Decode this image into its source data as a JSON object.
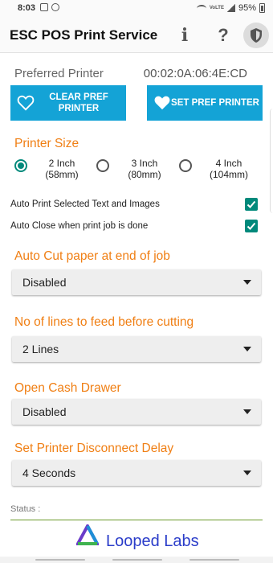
{
  "status_bar": {
    "time": "8:03",
    "lte_label": "VoLTE",
    "battery": "95%"
  },
  "app_bar": {
    "title": "ESC POS Print Service",
    "info_icon": "i",
    "help_icon": "?"
  },
  "preferred_printer": {
    "label": "Preferred Printer",
    "mac": "00:02:0A:06:4E:CD",
    "clear_button": "CLEAR PREF PRINTER",
    "set_button": "SET PREF PRINTER"
  },
  "printer_size": {
    "title": "Printer Size",
    "options": [
      {
        "label": "2 Inch\n(58mm)",
        "checked": true
      },
      {
        "label": "3 Inch\n(80mm)",
        "checked": false
      },
      {
        "label": "4 Inch\n(104mm)",
        "checked": false
      }
    ]
  },
  "options": {
    "auto_print": {
      "label": "Auto Print Selected Text and Images",
      "checked": true
    },
    "auto_close": {
      "label": "Auto Close when print job is done",
      "checked": true
    }
  },
  "auto_cut": {
    "title": "Auto Cut paper at end of job",
    "value": "Disabled"
  },
  "feed_lines": {
    "title": "No of lines to feed before cutting",
    "value": "2 Lines"
  },
  "cash_drawer": {
    "title": "Open Cash Drawer",
    "value": "Disabled"
  },
  "disconnect_delay": {
    "title": "Set Printer Disconnect Delay",
    "value": "4 Seconds"
  },
  "status": {
    "label": "Status :"
  },
  "footer": {
    "brand": "Looped Labs"
  },
  "colors": {
    "accent": "#f07f14",
    "button": "#14a3d6",
    "check": "#00897b",
    "brand": "#2a3cc9"
  },
  "icons": [
    "image-icon",
    "notification-circle-icon",
    "wifi-icon",
    "signal-icon",
    "battery-icon",
    "info-icon",
    "help-icon",
    "shield-icon",
    "heart-outline-icon",
    "heart-filled-icon",
    "checkmark-icon",
    "dropdown-arrow-icon",
    "looped-labs-logo"
  ]
}
